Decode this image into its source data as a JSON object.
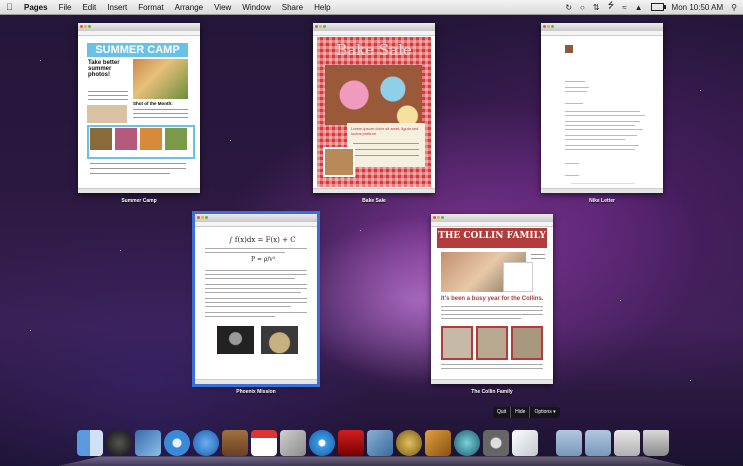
{
  "menubar": {
    "app_name": "Pages",
    "menus": [
      "File",
      "Edit",
      "Insert",
      "Format",
      "Arrange",
      "View",
      "Window",
      "Share",
      "Help"
    ],
    "clock": "Mon 10:50 AM"
  },
  "documents": [
    {
      "caption": "Summer Camp",
      "title": "SUMMER CAMP",
      "headline": "Take better summer photos!",
      "section": "Shot of the Month:"
    },
    {
      "caption": "Bake Sale",
      "title": "Bake Sale",
      "card_text": "Lorem ipsum dolor sit amet, ligula sed luctus pretium"
    },
    {
      "caption": "Nike Letter"
    },
    {
      "caption": "Phoenix Mission",
      "equation": "∫ f(x)dx = F(x) + C",
      "equation2": "P = ρ/v²"
    },
    {
      "caption": "The Collin Family",
      "title": "THE COLLIN FAMILY",
      "headline": "It's been a busy year for the Collins."
    }
  ],
  "window_controls": {
    "quit": "Quit",
    "hide": "Hide",
    "options": "Options ▾"
  },
  "dock": {
    "items": [
      "finder-icon",
      "dashboard-icon",
      "photos-icon",
      "safari-icon",
      "ichat-icon",
      "address-book-icon",
      "ical-icon",
      "preview-icon",
      "itunes-icon",
      "photo-booth-icon",
      "iphoto-icon",
      "imovie-icon",
      "garageband-icon",
      "time-machine-icon",
      "system-preferences-icon",
      "pages-icon",
      "applications-folder-icon",
      "documents-folder-icon",
      "downloads-icon",
      "trash-icon"
    ]
  }
}
